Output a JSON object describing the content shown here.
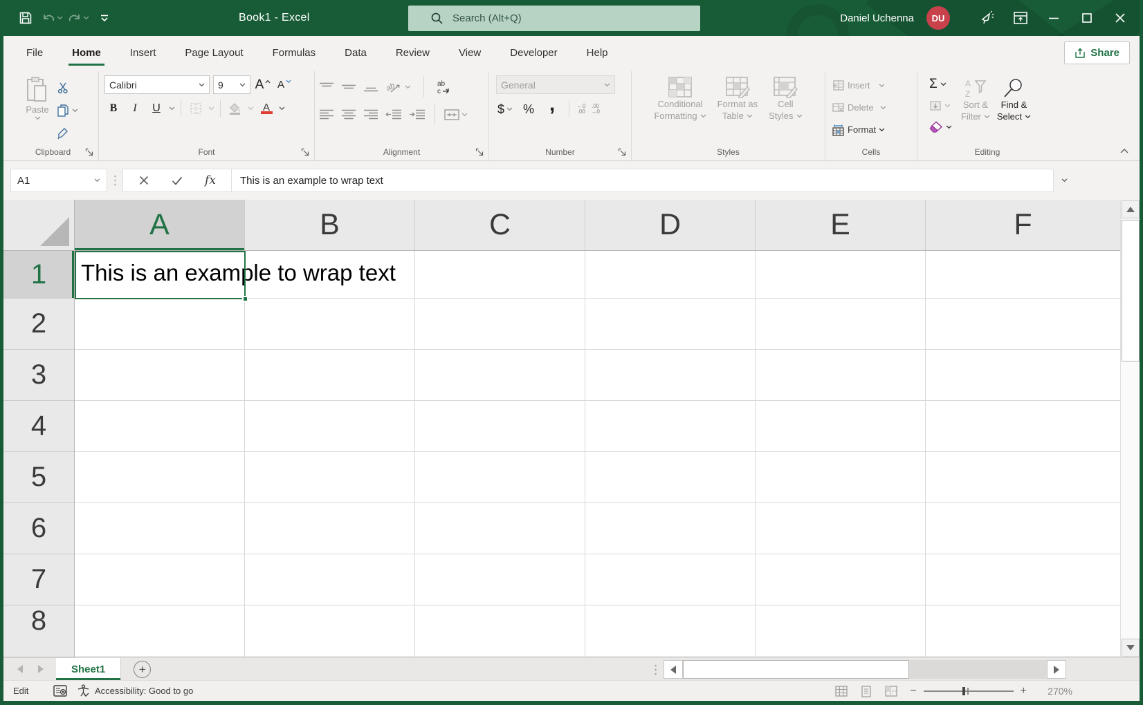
{
  "colors": {
    "accent_green": "#217346",
    "titlebar_green": "#185C37",
    "avatar_red": "#C8414B",
    "font_color_bar_red": "#E03C31"
  },
  "titlebar": {
    "title": "Book1 - Excel",
    "search_placeholder": "Search (Alt+Q)",
    "account_name": "Daniel Uchenna",
    "avatar_initials": "DU"
  },
  "menu": {
    "tabs": [
      "File",
      "Home",
      "Insert",
      "Page Layout",
      "Formulas",
      "Data",
      "Review",
      "View",
      "Developer",
      "Help"
    ],
    "active_tab": "Home",
    "share_label": "Share"
  },
  "ribbon": {
    "clipboard": {
      "label": "Clipboard",
      "paste": "Paste"
    },
    "font": {
      "label": "Font",
      "name": "Calibri",
      "size": "9",
      "bold": "B",
      "italic": "I",
      "underline": "U",
      "increase": "A",
      "decrease": "A",
      "color_letter": "A"
    },
    "alignment": {
      "label": "Alignment",
      "orientation_glyph": "ab",
      "wrap_glyph_1": "ab",
      "wrap_glyph_2": "c"
    },
    "number": {
      "label": "Number",
      "format": "General",
      "currency": "$",
      "percent": "%",
      "comma": ",",
      "inc_dec_1": "←0",
      "inc_dec_2": ".00",
      "dec_dec_1": ".00",
      "dec_dec_2": "→0"
    },
    "styles": {
      "label": "Styles",
      "cond_1": "Conditional",
      "cond_2": "Formatting",
      "table_1": "Format as",
      "table_2": "Table",
      "cell_1": "Cell",
      "cell_2": "Styles"
    },
    "cells": {
      "label": "Cells",
      "insert": "Insert",
      "delete": "Delete",
      "format": "Format"
    },
    "editing": {
      "label": "Editing",
      "autosum": "Σ",
      "sort_1": "Sort &",
      "sort_2": "Filter",
      "find_1": "Find &",
      "find_2": "Select"
    }
  },
  "formula_bar": {
    "name_box": "A1",
    "fx": "fx",
    "formula": "This is an example to wrap text"
  },
  "grid": {
    "columns": [
      "A",
      "B",
      "C",
      "D",
      "E",
      "F"
    ],
    "rows": [
      "1",
      "2",
      "3",
      "4",
      "5",
      "6",
      "7",
      "8"
    ],
    "active_cell": "A1",
    "a1_text": "This is an example to wrap text"
  },
  "sheet_bar": {
    "active_sheet": "Sheet1"
  },
  "status_bar": {
    "mode": "Edit",
    "accessibility": "Accessibility: Good to go",
    "zoom_level": "270%",
    "zoom_out": "−",
    "zoom_in": "+"
  }
}
